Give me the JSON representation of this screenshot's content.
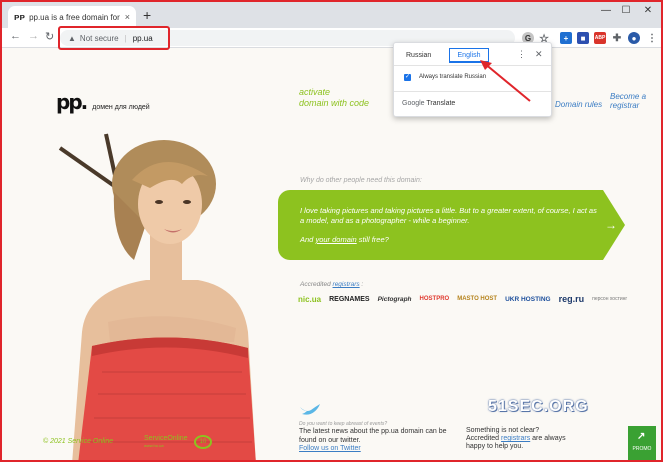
{
  "browser": {
    "tab_title": "pp.ua is a free domain for people",
    "tab_favicon": "ᴘᴘ",
    "tab_close": "×",
    "new_tab": "+",
    "window_minimize": "—",
    "window_maximize": "☐",
    "window_close": "✕",
    "back": "←",
    "forward": "→",
    "reload": "↻",
    "security_label": "Not secure",
    "url": "pp.ua"
  },
  "translate_popup": {
    "lang_source": "Russian",
    "lang_target": "English",
    "menu": "⋮",
    "close": "✕",
    "always_translate": "Always translate Russian",
    "footer": "Google Translate",
    "footer_google": "Google",
    "footer_translate": " Translate"
  },
  "page": {
    "logo_mark": "pp.",
    "logo_text": "домен для людей",
    "activate_line1": "activate",
    "activate_line2": "domain with code",
    "domain_rules": "Domain rules",
    "become_line1": "Become a",
    "become_line2": "registrar",
    "why": "Why do other people need this domain:",
    "quote1": "I love taking pictures and taking pictures a little. But to a greater extent, of course, I act as a model, and as a photographer - while a beginner.",
    "quote2_before": "And ",
    "quote2_link": "your domain",
    "quote2_after": " still free?",
    "go_arrow": "→",
    "accredited_before": "Accredited ",
    "accredited_link": "registrars",
    "accredited_after": " :",
    "registrars": [
      "nic.ua",
      "REGNAMES",
      "Pictograph",
      "HOSTPRO",
      "MASTO HOST",
      "UKR HOSTING",
      "reg.ru",
      "персон хостинг"
    ],
    "keep_informed": "Do you want to keep abreast of events?",
    "news_text": "The latest news about the pp.ua domain can be found on our twitter.",
    "follow": "Follow us on Twitter",
    "something_line1": "Something is not clear?",
    "something_before": "Accredited ",
    "something_link": "registrars",
    "something_after": " are always happy to help you.",
    "copyright": "© 2021 Service Online",
    "service_logo": "ServiceOnline",
    "service_logo_sub": "www.ho.ua",
    "service_ring": "10",
    "promo": "PROMO",
    "watermark": "51SEC.ORG"
  },
  "colors": {
    "accent_green": "#8dc21f",
    "link_blue": "#3b7dc4",
    "highlight_red": "#e0252b",
    "chrome_blue": "#1a73e8"
  }
}
